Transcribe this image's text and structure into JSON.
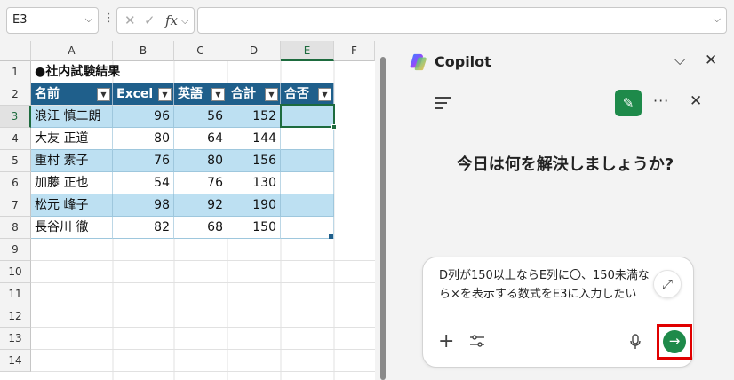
{
  "formula_bar": {
    "name_box": "E3",
    "formula": ""
  },
  "columns": [
    "A",
    "B",
    "C",
    "D",
    "E",
    "F"
  ],
  "rows": [
    "1",
    "2",
    "3",
    "4",
    "5",
    "6",
    "7",
    "8",
    "9",
    "10",
    "11",
    "12",
    "13",
    "14"
  ],
  "sheet": {
    "title": "●社内試験結果",
    "headers": [
      "名前",
      "Excel",
      "英語",
      "合計",
      "合否"
    ],
    "data": [
      {
        "name": "浪江 慎二朗",
        "excel": "96",
        "english": "56",
        "total": "152",
        "result": ""
      },
      {
        "name": "大友 正道",
        "excel": "80",
        "english": "64",
        "total": "144",
        "result": ""
      },
      {
        "name": "重村 素子",
        "excel": "76",
        "english": "80",
        "total": "156",
        "result": ""
      },
      {
        "name": "加藤 正也",
        "excel": "54",
        "english": "76",
        "total": "130",
        "result": ""
      },
      {
        "name": "松元 峰子",
        "excel": "98",
        "english": "92",
        "total": "190",
        "result": ""
      },
      {
        "name": "長谷川 徹",
        "excel": "82",
        "english": "68",
        "total": "150",
        "result": ""
      }
    ]
  },
  "copilot": {
    "title": "Copilot",
    "greeting": "今日は何を解決しましょうか?",
    "prompt": "D列が150以上ならE列に〇、150未満なら×を表示する数式をE3に入力したい",
    "colors": {
      "accent": "#1e8a4a",
      "highlight": "#e00000"
    }
  },
  "colors": {
    "table_header": "#1f5f8b",
    "band": "#bde0f2",
    "selection": "#1d6b3e"
  }
}
